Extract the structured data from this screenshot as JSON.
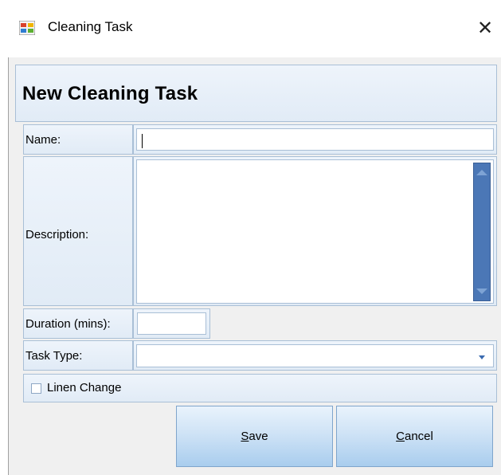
{
  "window": {
    "title": "Cleaning Task",
    "close_glyph": "✕",
    "icon": "form-icon"
  },
  "form": {
    "heading": "New Cleaning Task",
    "name_label": "Name:",
    "name_value": "",
    "description_label": "Description:",
    "description_value": "",
    "duration_label": "Duration (mins):",
    "duration_value": "",
    "task_type_label": "Task Type:",
    "task_type_value": "",
    "linen_change_label": "Linen Change",
    "linen_change_checked": false
  },
  "buttons": {
    "save_mnemonic": "S",
    "save_rest": "ave",
    "cancel_mnemonic": "C",
    "cancel_rest": "ancel"
  },
  "colors": {
    "accent": "#4b77b6",
    "cell_border": "#a9bfd6"
  }
}
